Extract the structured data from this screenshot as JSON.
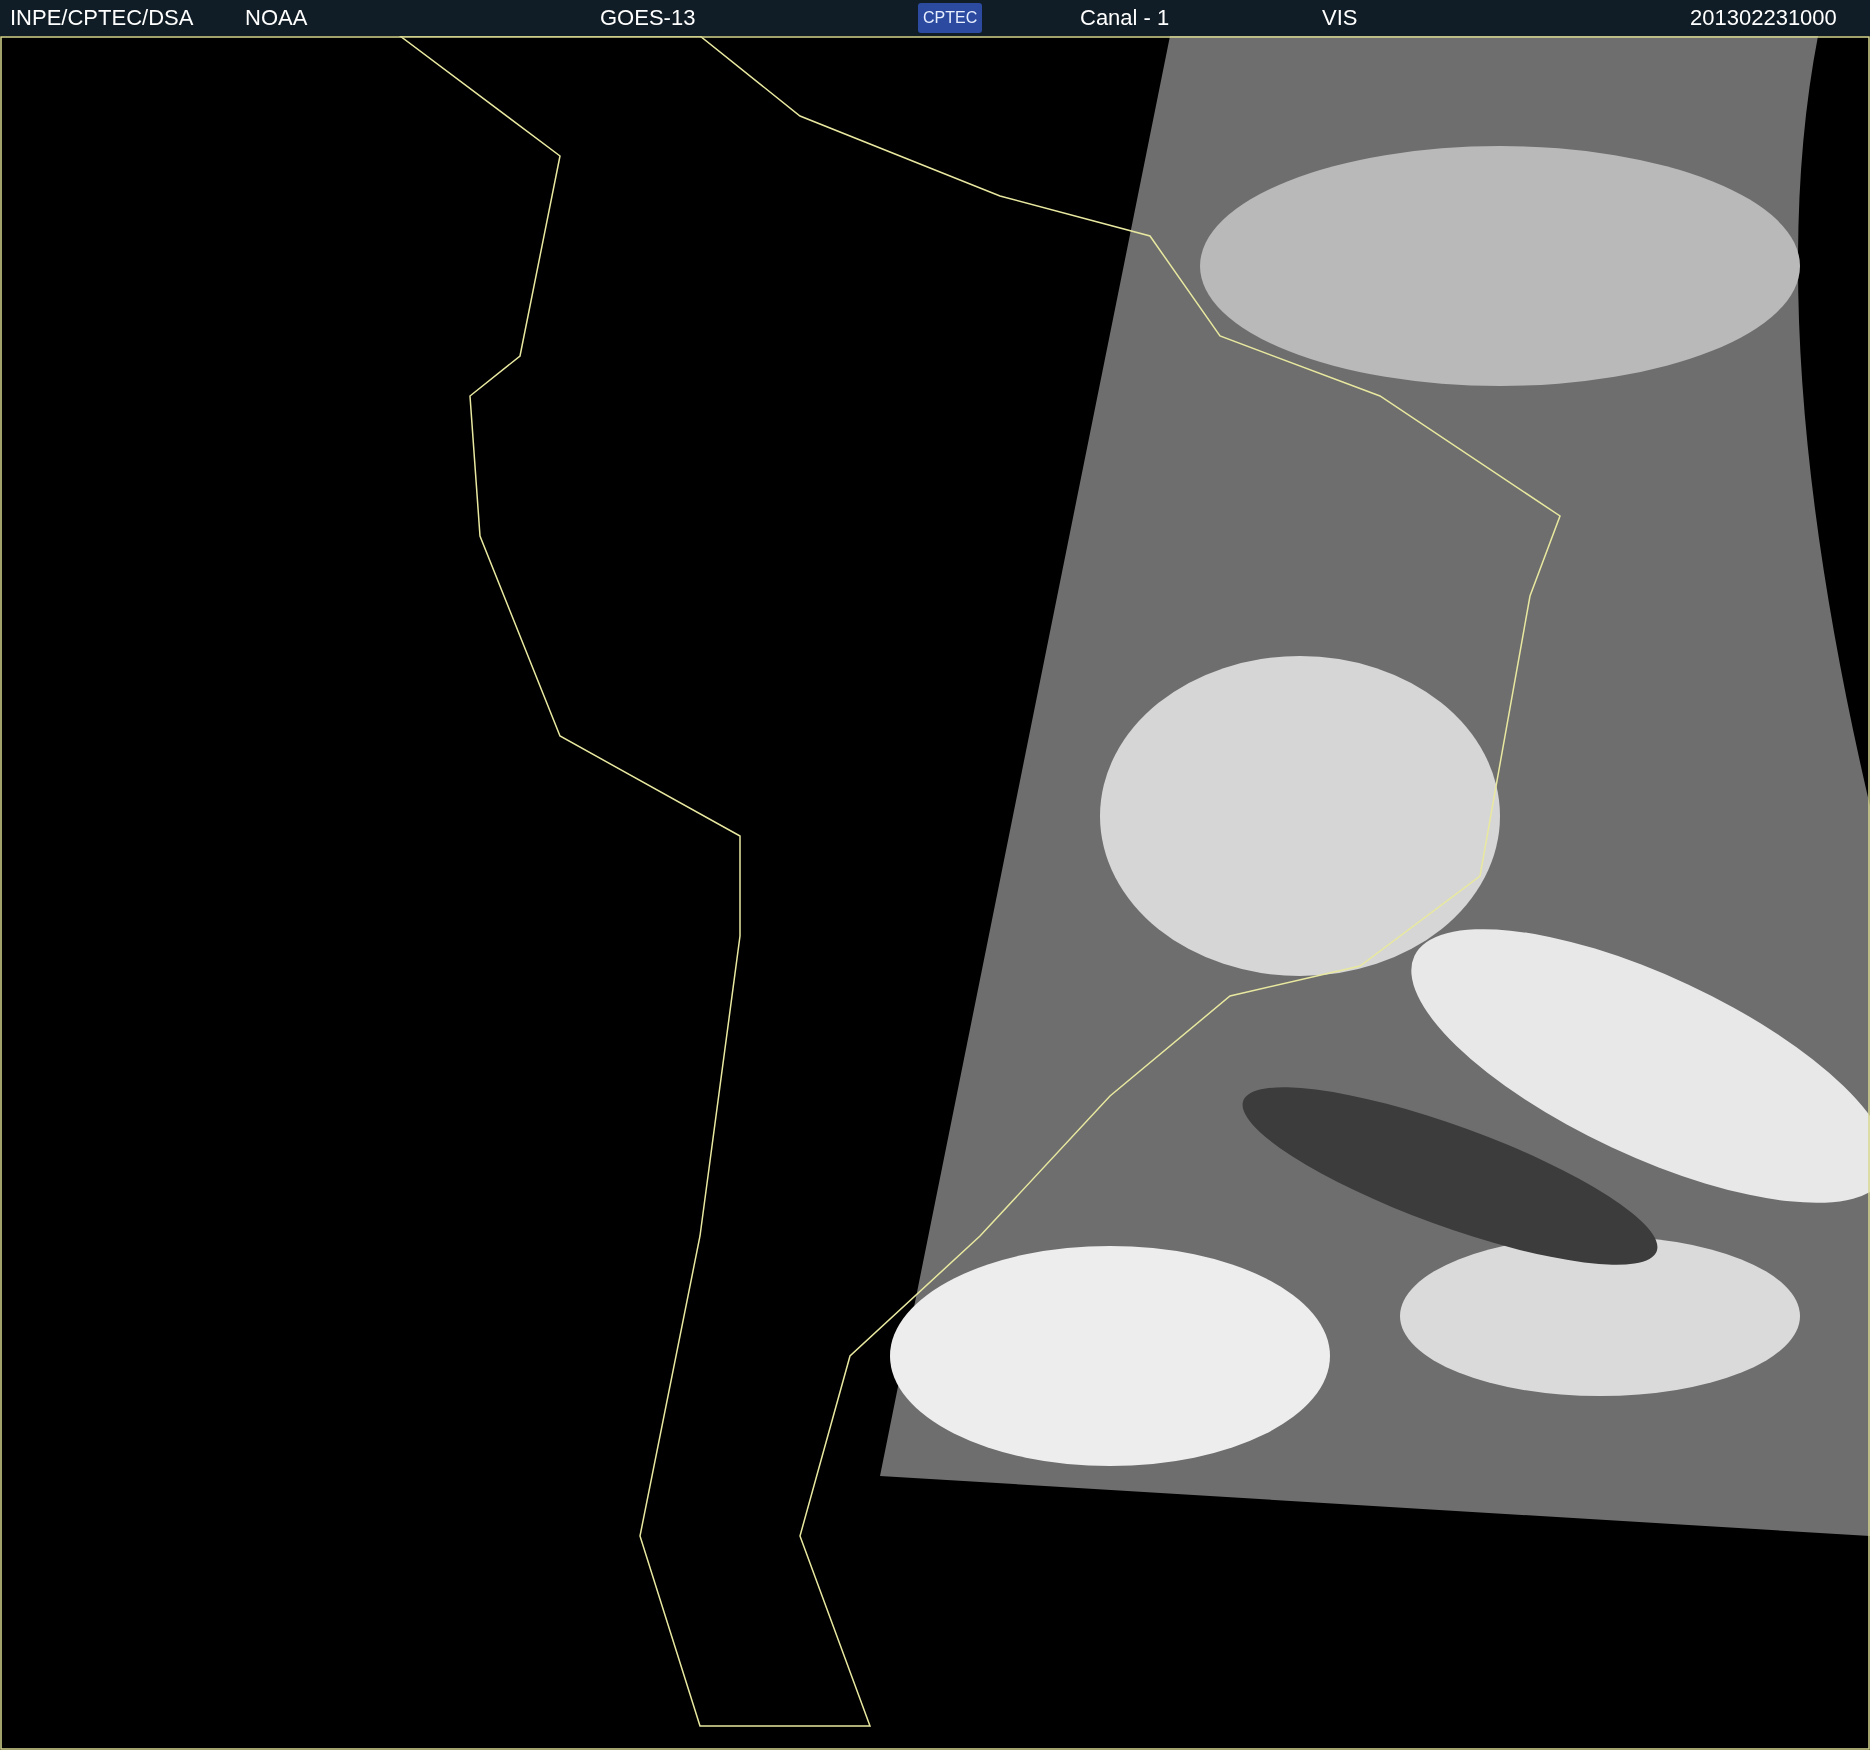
{
  "header": {
    "items": [
      {
        "kind": "text",
        "text": "INPE/CPTEC/DSA"
      },
      {
        "kind": "text",
        "text": "NOAA"
      },
      {
        "kind": "text",
        "text": "GOES-13"
      },
      {
        "kind": "logo",
        "text": "CPTEC"
      },
      {
        "kind": "text",
        "text": "Canal - 1"
      },
      {
        "kind": "text",
        "text": "VIS"
      },
      {
        "kind": "text",
        "text": "201302231000"
      }
    ]
  }
}
